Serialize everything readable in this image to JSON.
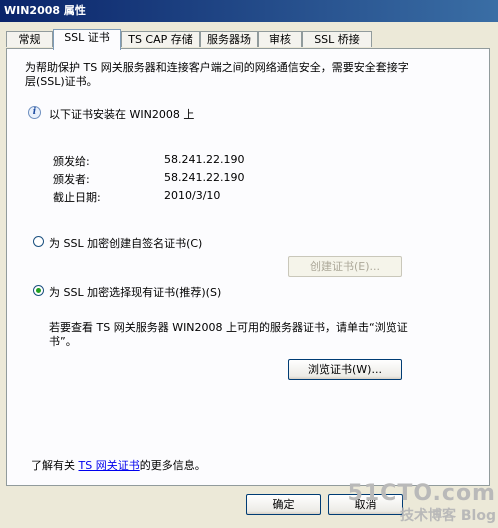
{
  "window": {
    "title": "WIN2008 属性"
  },
  "tabs": [
    {
      "label": "常规"
    },
    {
      "label": "SSL 证书"
    },
    {
      "label": "TS CAP 存储"
    },
    {
      "label": "服务器场"
    },
    {
      "label": "审核"
    },
    {
      "label": "SSL 桥接"
    }
  ],
  "description": {
    "line1": "为帮助保护 TS 网关服务器和连接客户端之间的网络通信安全，需要安全套接字",
    "line2": "层(SSL)证书。"
  },
  "cert_info": {
    "heading": "以下证书安装在 WIN2008 上",
    "issued_to_label": "颁发给:",
    "issued_to_value": "58.241.22.190",
    "issued_by_label": "颁发者:",
    "issued_by_value": "58.241.22.190",
    "expiry_label": "截止日期:",
    "expiry_value": "2010/3/10"
  },
  "option_self_signed": {
    "label": "为 SSL 加密创建自签名证书(C)",
    "checked": false,
    "button_label": "创建证书(E)..."
  },
  "option_existing": {
    "label": "为 SSL 加密选择现有证书(推荐)(S)",
    "checked": true,
    "hint_line1": "若要查看 TS 网关服务器 WIN2008 上可用的服务器证书，请单击“浏览证",
    "hint_line2": "书”。",
    "button_label": "浏览证书(W)..."
  },
  "footer_info": {
    "prefix": "了解有关",
    "link": "TS 网关证书",
    "suffix": "的更多信息。"
  },
  "buttons": {
    "ok": "确定",
    "cancel": "取消"
  },
  "watermark": {
    "line1": "51CTO.com",
    "line2": "技术博客 Blog"
  }
}
